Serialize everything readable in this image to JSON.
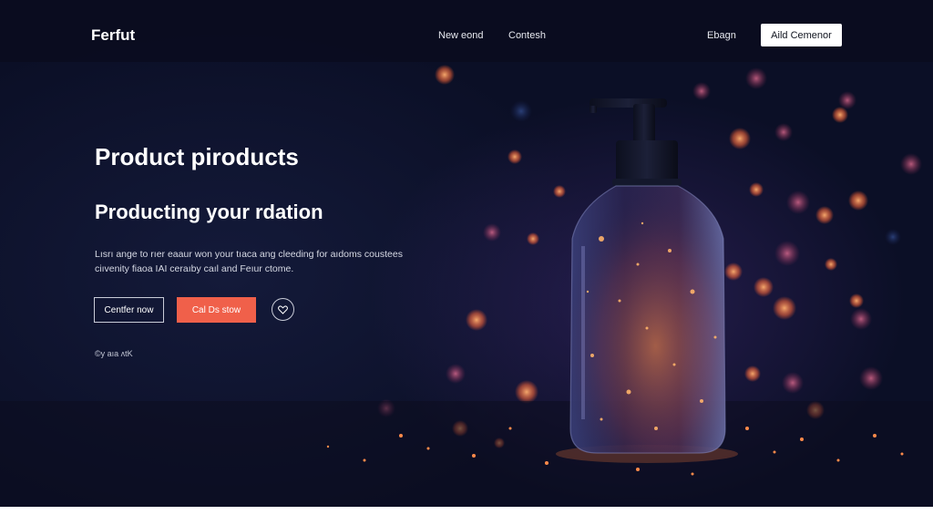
{
  "header": {
    "logo": "Ferfut",
    "nav": [
      "New eond",
      "Contesh",
      "Ebagn"
    ],
    "cta_label": "Aild Cemenor"
  },
  "hero": {
    "title": "Product piroducts",
    "subtitle": "Producting your rdation",
    "description": "Lısrı ange to rıer eaaur won your tıaca ang cleeding for aıdoms coustees ciıvenity fiaoa IAI ceraıby caıl and Feıur ctome.",
    "primary_outline_label": "Centfer now",
    "primary_label": "Cal Ds stow",
    "note": "©y aıa ʌtK"
  },
  "colors": {
    "accent": "#f0604a",
    "background": "#0b0f26",
    "bokeh": "#ff7a3c"
  },
  "icons": {
    "circle_button": "heart-icon"
  }
}
